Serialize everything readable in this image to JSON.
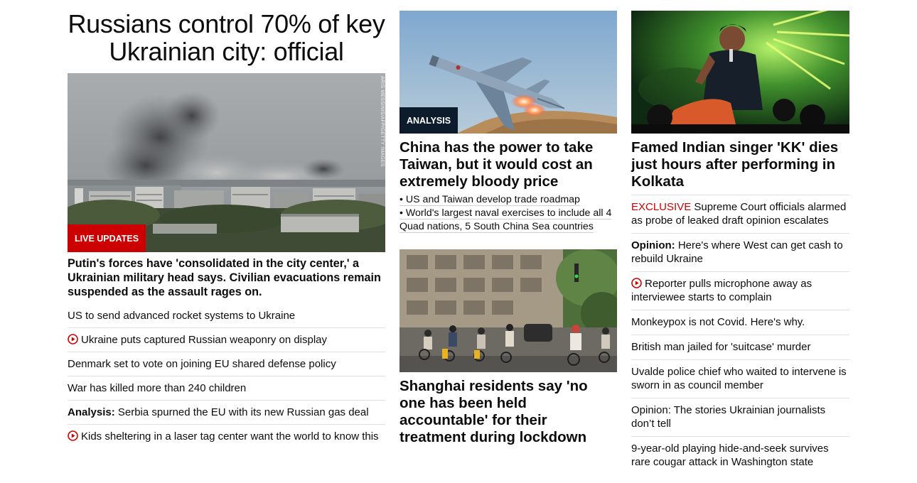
{
  "lead": {
    "title": "Russians control 70% of key Ukrainian city: official",
    "badge": "LIVE UPDATES",
    "photo_credit": "ARIS MESSINIS/AFP/GETTY IMAGES",
    "description": "Putin's forces have 'consolidated in the city center,' a Ukrainian military head says. Civilian evacuations remain suspended as the assault rages on.",
    "links": [
      {
        "kicker": "",
        "text": "US to send advanced rocket systems to Ukraine",
        "video": false
      },
      {
        "kicker": "",
        "text": "Ukraine puts captured Russian weaponry on display",
        "video": true
      },
      {
        "kicker": "",
        "text": "Denmark set to vote on joining EU shared defense policy",
        "video": false
      },
      {
        "kicker": "",
        "text": "War has killed more than 240 children",
        "video": false
      },
      {
        "kicker": "Analysis:",
        "text": " Serbia spurned the EU with its new Russian gas deal",
        "video": false
      },
      {
        "kicker": "",
        "text": "Kids sheltering in a laser tag center want the world to know this",
        "video": true
      }
    ]
  },
  "middle": {
    "story1": {
      "badge": "ANALYSIS",
      "headline": "China has the power to take Taiwan, but it would cost an extremely bloody price",
      "bullets": [
        "• US and Taiwan develop trade roadmap",
        "• World's largest naval exercises to include all 4 Quad nations, 5 South China Sea countries"
      ]
    },
    "story2": {
      "headline": "Shanghai residents say 'no one has been held accountable' for their treatment during lockdown"
    }
  },
  "right": {
    "story": {
      "headline": "Famed Indian singer 'KK' dies just hours after performing in Kolkata"
    },
    "links": [
      {
        "kicker": "EXCLUSIVE",
        "kicker_style": "red",
        "text": " Supreme Court officials alarmed as probe of leaked draft opinion escalates",
        "video": false
      },
      {
        "kicker": "Opinion:",
        "kicker_style": "bold",
        "text": " Here's where West can get cash to rebuild Ukraine",
        "video": false
      },
      {
        "kicker": "",
        "kicker_style": "",
        "text": "Reporter pulls microphone away as interviewee starts to complain",
        "video": true
      },
      {
        "kicker": "",
        "kicker_style": "",
        "text": "Monkeypox is not Covid. Here's why.",
        "video": false
      },
      {
        "kicker": "",
        "kicker_style": "",
        "text": "British man jailed for 'suitcase' murder",
        "video": false
      },
      {
        "kicker": "",
        "kicker_style": "",
        "text": "Uvalde police chief who waited to intervene is sworn in as council member",
        "video": false
      },
      {
        "kicker": "",
        "kicker_style": "",
        "text": "Opinion: The stories Ukrainian journalists don’t tell",
        "video": false
      },
      {
        "kicker": "",
        "kicker_style": "",
        "text": "9-year-old playing hide-and-seek survives rare cougar attack in Washington state",
        "video": false
      }
    ]
  },
  "colors": {
    "accent_red": "#cc0000",
    "analysis_badge": "#0c1c2c",
    "text": "#0c0c0c",
    "divider": "#dfdfdf"
  }
}
